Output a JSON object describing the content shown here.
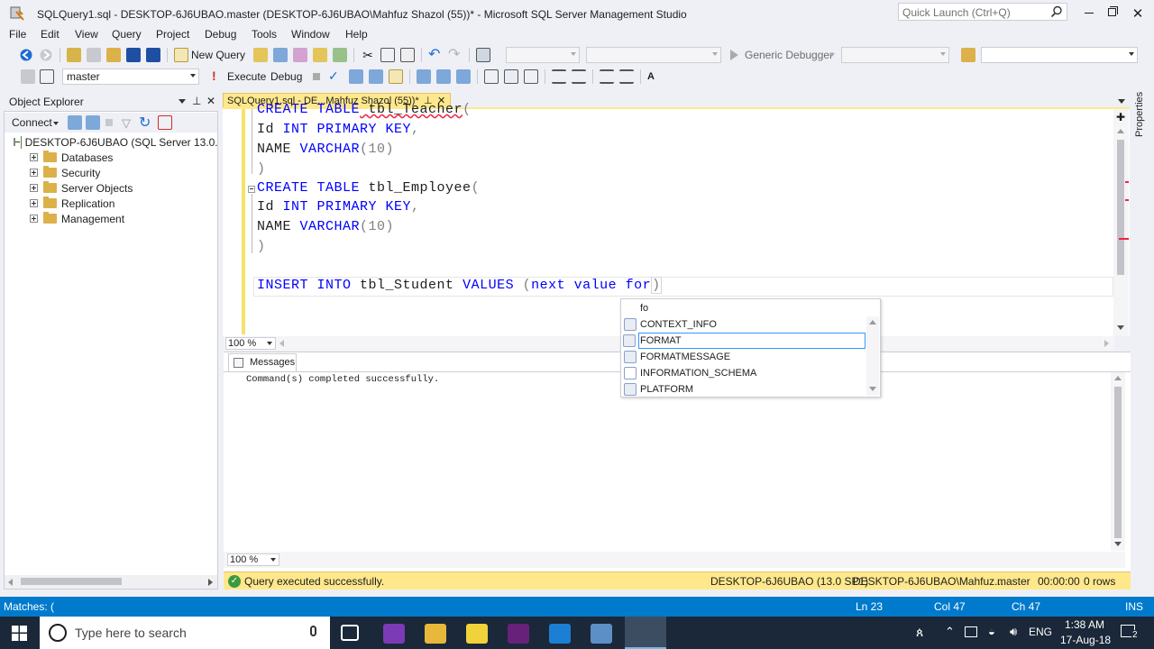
{
  "window": {
    "title": "SQLQuery1.sql - DESKTOP-6J6UBAO.master (DESKTOP-6J6UBAO\\Mahfuz Shazol (55))* - Microsoft SQL Server Management Studio",
    "quick_launch_placeholder": "Quick Launch (Ctrl+Q)"
  },
  "menu": [
    "File",
    "Edit",
    "View",
    "Query",
    "Project",
    "Debug",
    "Tools",
    "Window",
    "Help"
  ],
  "toolbar1": {
    "new_query": "New Query",
    "debugger": "Generic Debugger"
  },
  "toolbar2": {
    "database": "master",
    "execute": "Execute",
    "debug": "Debug"
  },
  "object_explorer": {
    "title": "Object Explorer",
    "connect": "Connect",
    "server": "DESKTOP-6J6UBAO (SQL Server 13.0.40",
    "items": [
      "Databases",
      "Security",
      "Server Objects",
      "Replication",
      "Management"
    ]
  },
  "properties_tab": "Properties",
  "editor": {
    "tab_label": "SQLQuery1.sql - DE...Mahfuz Shazol (55))*",
    "zoom": "100 %",
    "lines": {
      "l1_kw": "CREATE TABLE",
      "l1_name": " tbl_Teacher",
      "l1_paren": "(",
      "l2_name": "Id ",
      "l2_kw": "INT PRIMARY KEY",
      "l2_comma": ",",
      "l3_name": "NAME ",
      "l3_kw": "VARCHAR",
      "l3_rest": "(10)",
      "l4": ")",
      "l5_kw": "CREATE TABLE",
      "l5_name": " tbl_Employee",
      "l5_paren": "(",
      "l6_name": "Id ",
      "l6_kw": "INT PRIMARY KEY",
      "l6_comma": ",",
      "l7_name": "NAME ",
      "l7_kw": "VARCHAR",
      "l7_rest": "(10)",
      "l8": ")",
      "l9_kw1": "INSERT INTO",
      "l9_name": " tbl_Student ",
      "l9_kw2": "VALUES",
      "l9_paren": " (",
      "l9_kw3": "next value for",
      "l9_close": ")"
    }
  },
  "autocomplete": {
    "typed": "fo",
    "items": [
      "CONTEXT_INFO",
      "FORMAT",
      "FORMATMESSAGE",
      "INFORMATION_SCHEMA",
      "PLATFORM"
    ],
    "selected_index": 1
  },
  "results": {
    "tab": "Messages",
    "message": "Command(s) completed successfully.",
    "zoom": "100 %"
  },
  "query_status": {
    "message": "Query executed successfully.",
    "server": "DESKTOP-6J6UBAO (13.0 SP1)",
    "user": "DESKTOP-6J6UBAO\\Mahfuz...",
    "database": "master",
    "elapsed": "00:00:00",
    "rows": "0 rows"
  },
  "status_bar": {
    "left": "Matches: (",
    "ln": "Ln 23",
    "col": "Col 47",
    "ch": "Ch 47",
    "mode": "INS"
  },
  "taskbar": {
    "search_placeholder": "Type here to search",
    "lang": "ENG",
    "time": "1:38 AM",
    "date": "17-Aug-18",
    "notifications": "2"
  },
  "colors": {
    "accent_blue": "#007acc",
    "tab_yellow": "#ffe88c",
    "keyword": "#0000ff",
    "taskbar": "#1a2839"
  }
}
